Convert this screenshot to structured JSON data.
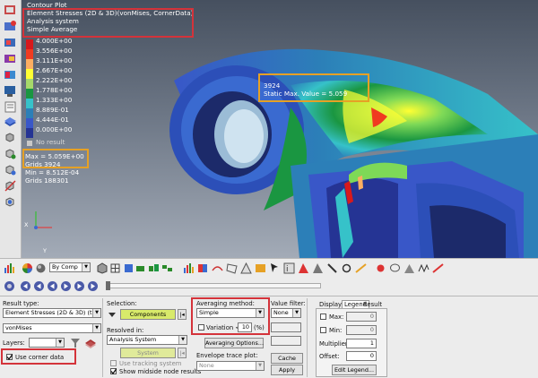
{
  "viewport": {
    "title_lines": [
      "Contour Plot",
      "Element Stresses (2D & 3D)(vonMises, CornerData)",
      "Analysis system",
      "Simple Average"
    ],
    "legend_values": [
      "4.000E+00",
      "3.556E+00",
      "3.111E+00",
      "2.667E+00",
      "2.222E+00",
      "1.778E+00",
      "1.333E+00",
      "8.889E-01",
      "4.444E-01",
      "0.000E+00"
    ],
    "legend_colors": [
      "#d7191c",
      "#f03b20",
      "#fdae61",
      "#ffff33",
      "#a6d96a",
      "#1a9641",
      "#36c2c9",
      "#2c7fb8",
      "#3957c8",
      "#253494"
    ],
    "no_result_label": "No result",
    "max_text": "Max = 5.059E+00",
    "max_grids": "Grids 3924",
    "min_text": "Min = 8.512E-04",
    "min_grids": "Grids 188301",
    "probe_id": "3924",
    "probe_text": "Static Max. Value = 5.059",
    "axis_x": "X",
    "axis_y": "Y"
  },
  "toolbar": {
    "display_mode": "By Comp"
  },
  "panel": {
    "result_type_label": "Result type:",
    "result_type_value": "Element Stresses (2D & 3D) (t)",
    "component_value": "vonMises",
    "layers_label": "Layers:",
    "use_corner_data": "Use corner data",
    "selection_label": "Selection:",
    "components_button": "Components",
    "resolved_in_label": "Resolved in:",
    "resolved_value": "Analysis System",
    "system_button": "System",
    "use_tracking": "Use tracking system",
    "show_midside": "Show midside node results",
    "averaging_label": "Averaging method:",
    "averaging_value": "Simple",
    "variation_label": "Variation <",
    "variation_value": "10",
    "variation_unit": "(%)",
    "averaging_options": "Averaging Options...",
    "envelope_label": "Envelope trace plot:",
    "envelope_value": "None",
    "value_filter_label": "Value filter:",
    "value_filter_value": "None",
    "cache_button": "Cache",
    "apply_button": "Apply",
    "tabs": [
      "Display",
      "Legend",
      "Result"
    ],
    "max_label": "Max:",
    "max_value": "0",
    "min_label": "Min:",
    "min_value": "0",
    "multiplier_label": "Multiplier:",
    "multiplier_value": "1",
    "offset_label": "Offset:",
    "offset_value": "0",
    "edit_legend": "Edit Legend..."
  }
}
